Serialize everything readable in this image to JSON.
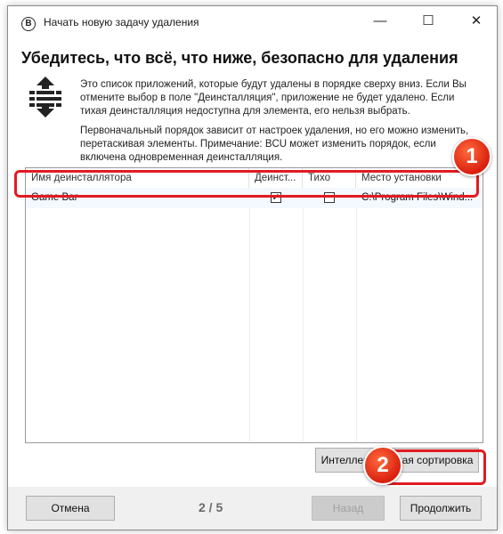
{
  "window": {
    "app_icon": "B",
    "title": "Начать новую задачу удаления",
    "minimize_glyph": "—",
    "maximize_glyph": "☐",
    "close_glyph": "✕"
  },
  "heading": "Убедитесь, что всё, что ниже, безопасно для удаления",
  "icon": "sort-order-icon",
  "description": {
    "para1": "Это список приложений, которые будут удалены в порядке сверху вниз. Если Вы отмените выбор в поле \"Деинсталляция\", приложение не будет удалено. Если тихая деинсталляция недоступна для элемента, его нельзя выбрать.",
    "para2": "Первоначальный порядок зависит от настроек удаления, но его можно изменить, перетаскивая элементы. Примечание: BCU может изменить порядок, если включена одновременная деинсталляция."
  },
  "table": {
    "columns": [
      "Имя деинсталлятора",
      "Деинст...",
      "Тихо",
      "Место установки"
    ],
    "rows": [
      {
        "name": "Game Bar",
        "uninstall": true,
        "uninstall_mark": "✓",
        "quiet": false,
        "location": "C:\\Program Files\\Wind..."
      }
    ]
  },
  "buttons": {
    "smart_sort": "Интеллектуальная сортировка",
    "cancel": "Отмена",
    "back": "Назад",
    "next": "Продолжить"
  },
  "page_indicator": "2 / 5",
  "annotations": {
    "badge1": "1",
    "badge2": "2",
    "highlight_color": "#e11b22"
  }
}
